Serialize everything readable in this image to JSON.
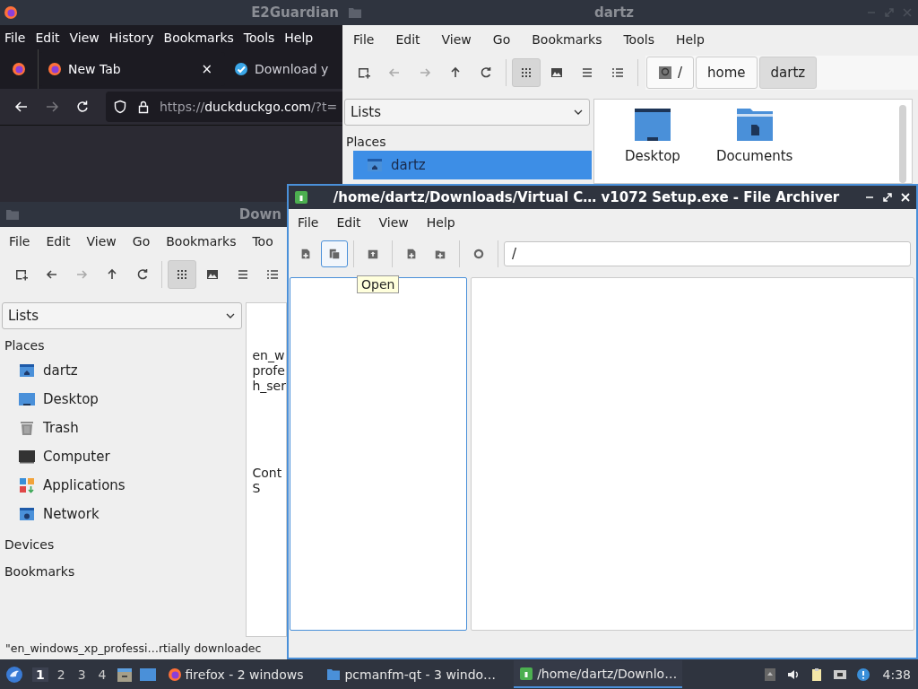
{
  "firefox": {
    "title": "E2Guardian",
    "menu": [
      "File",
      "Edit",
      "View",
      "History",
      "Bookmarks",
      "Tools",
      "Help"
    ],
    "tabs": [
      {
        "label": "New Tab",
        "selected": true,
        "close": "×",
        "kind": "firefox"
      },
      {
        "label": "Download y",
        "selected": false,
        "kind": "check"
      }
    ],
    "url": {
      "scheme": "https://",
      "host": "duckduckgo.com",
      "rest": "/?t="
    }
  },
  "dartz_window": {
    "title": "dartz",
    "menu": [
      "File",
      "Edit",
      "View",
      "Go",
      "Bookmarks",
      "Tools",
      "Help"
    ],
    "nav": [
      {
        "kind": "new-tab",
        "disabled": false
      },
      {
        "kind": "back",
        "disabled": true
      },
      {
        "kind": "forward",
        "disabled": true
      },
      {
        "kind": "up",
        "disabled": false
      },
      {
        "kind": "reload",
        "disabled": false
      }
    ],
    "view_modes": [
      {
        "kind": "grid",
        "selected": true
      },
      {
        "kind": "image",
        "selected": false
      },
      {
        "kind": "list",
        "selected": false
      },
      {
        "kind": "detail",
        "selected": false
      }
    ],
    "path": [
      {
        "label": "/",
        "selected": false
      },
      {
        "label": "home",
        "selected": false
      },
      {
        "label": "dartz",
        "selected": true
      }
    ],
    "side": {
      "combo": "Lists",
      "sections": [
        {
          "label": "Places",
          "items": [
            {
              "label": "dartz",
              "kind": "home",
              "selected": true
            }
          ]
        }
      ]
    },
    "files": [
      {
        "label": "Desktop",
        "kind": "desktop"
      },
      {
        "label": "Documents",
        "kind": "documents"
      }
    ]
  },
  "downloads_window": {
    "title": "Down",
    "menu": [
      "File",
      "Edit",
      "View",
      "Go",
      "Bookmarks",
      "Too"
    ],
    "nav": [
      {
        "kind": "new-tab",
        "disabled": false
      },
      {
        "kind": "back",
        "disabled": false
      },
      {
        "kind": "forward",
        "disabled": true
      },
      {
        "kind": "up",
        "disabled": false
      },
      {
        "kind": "reload",
        "disabled": false
      }
    ],
    "view_modes": [
      {
        "kind": "grid",
        "selected": true
      },
      {
        "kind": "image",
        "selected": false
      },
      {
        "kind": "list",
        "selected": false
      },
      {
        "kind": "detail",
        "selected": false
      }
    ],
    "side": {
      "combo": "Lists",
      "sections": [
        {
          "label": "Places",
          "items": [
            {
              "label": "dartz",
              "kind": "home",
              "selected": false
            },
            {
              "label": "Desktop",
              "kind": "desktop",
              "selected": false
            },
            {
              "label": "Trash",
              "kind": "trash",
              "selected": false
            },
            {
              "label": "Computer",
              "kind": "computer",
              "selected": false
            },
            {
              "label": "Applications",
              "kind": "applications",
              "selected": false
            },
            {
              "label": "Network",
              "kind": "network",
              "selected": false
            }
          ]
        },
        {
          "label": "Devices"
        },
        {
          "label": "Bookmarks"
        }
      ]
    },
    "files": [
      {
        "lines": [
          "en_w",
          "profe",
          "h_ser"
        ]
      },
      {
        "lines": [
          "Cont",
          "S"
        ]
      }
    ],
    "status": "\"en_windows_xp_professi…rtially downloadec"
  },
  "archiver": {
    "title": "/home/dartz/Downloads/Virtual C…  v1072 Setup.exe - File Archiver",
    "menu": [
      "File",
      "Edit",
      "View",
      "Help"
    ],
    "tools": [
      {
        "kind": "new",
        "hovered": false
      },
      {
        "kind": "open",
        "hovered": true
      },
      {
        "kind": "extract",
        "hovered": false
      },
      {
        "kind": "add-file",
        "hovered": false
      },
      {
        "kind": "add-folder",
        "hovered": false
      },
      {
        "kind": "stop",
        "hovered": false
      }
    ],
    "path": "/",
    "tooltip": "Open"
  },
  "taskbar": {
    "workspaces": [
      {
        "label": "1",
        "selected": true
      },
      {
        "label": "2",
        "selected": false
      },
      {
        "label": "3",
        "selected": false
      },
      {
        "label": "4",
        "selected": false
      }
    ],
    "tasks": [
      {
        "label": "firefox - 2 windows",
        "kind": "firefox",
        "selected": false
      },
      {
        "label": "pcmanfm-qt - 3 windo…",
        "kind": "folder",
        "selected": false
      },
      {
        "label": "/home/dartz/Downlo…",
        "kind": "archive",
        "selected": true
      }
    ],
    "clock": "4:38"
  }
}
